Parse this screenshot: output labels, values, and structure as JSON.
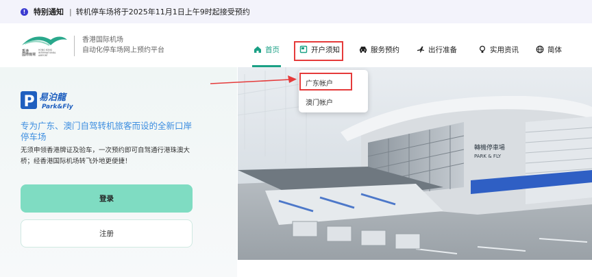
{
  "notice": {
    "icon": "info-icon",
    "tag": "特别通知",
    "separator": "|",
    "text": "转机停车场将于2025年11月1日上午9时起接受预约"
  },
  "header": {
    "logo_text_line1": "香港国际机场",
    "logo_text_line2": "自动化停车场网上预约平台",
    "logo_small": "HONG KONG INTERNATIONAL AIRPORT"
  },
  "nav": {
    "home": "首页",
    "account": "开户须知",
    "service": "服务预约",
    "travel": "出行准备",
    "info": "实用资讯",
    "lang": "简体"
  },
  "dropdown": {
    "items": [
      "广东帐户",
      "澳门帐户"
    ]
  },
  "left": {
    "brand_cn": "易泊龍",
    "brand_en": "Park&Fly",
    "headline": "专为广东、澳门自驾转机旅客而设的全新口岸停车场",
    "description": "无须申领香港牌证及验车，一次预约即可自驾通行港珠澳大桥；经香港国际机场转飞外地更便捷！",
    "login": "登录",
    "register": "注册"
  },
  "hero": {
    "building_sign_cn": "轉機停車場",
    "building_sign_en": "PARK & FLY"
  },
  "colors": {
    "accent": "#1aa085",
    "headline": "#3d8ee0",
    "login_button": "#7fdcc2",
    "highlight": "#e53a3a",
    "notice_bg": "#f3f3fb"
  }
}
